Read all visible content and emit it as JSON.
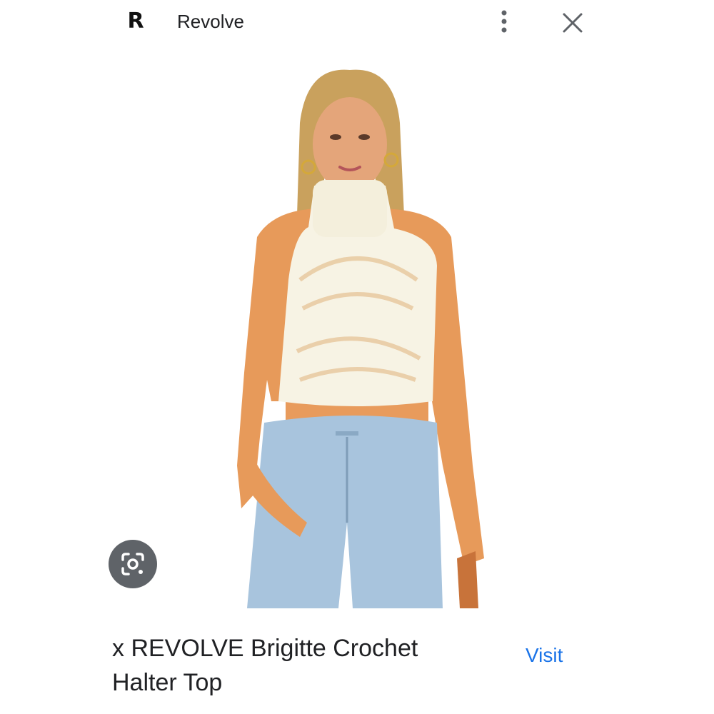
{
  "header": {
    "logo_letter": "R",
    "site_name": "Revolve",
    "more_icon": "more-vert-icon",
    "close_icon": "close-icon"
  },
  "image": {
    "description_icon": "product-photo",
    "lens_icon": "lens-icon"
  },
  "product": {
    "title": "x REVOLVE Brigitte Crochet Halter Top",
    "visit_label": "Visit"
  },
  "colors": {
    "link": "#1a73e8",
    "lens_button_bg": "#5f6368",
    "text": "#202124"
  }
}
